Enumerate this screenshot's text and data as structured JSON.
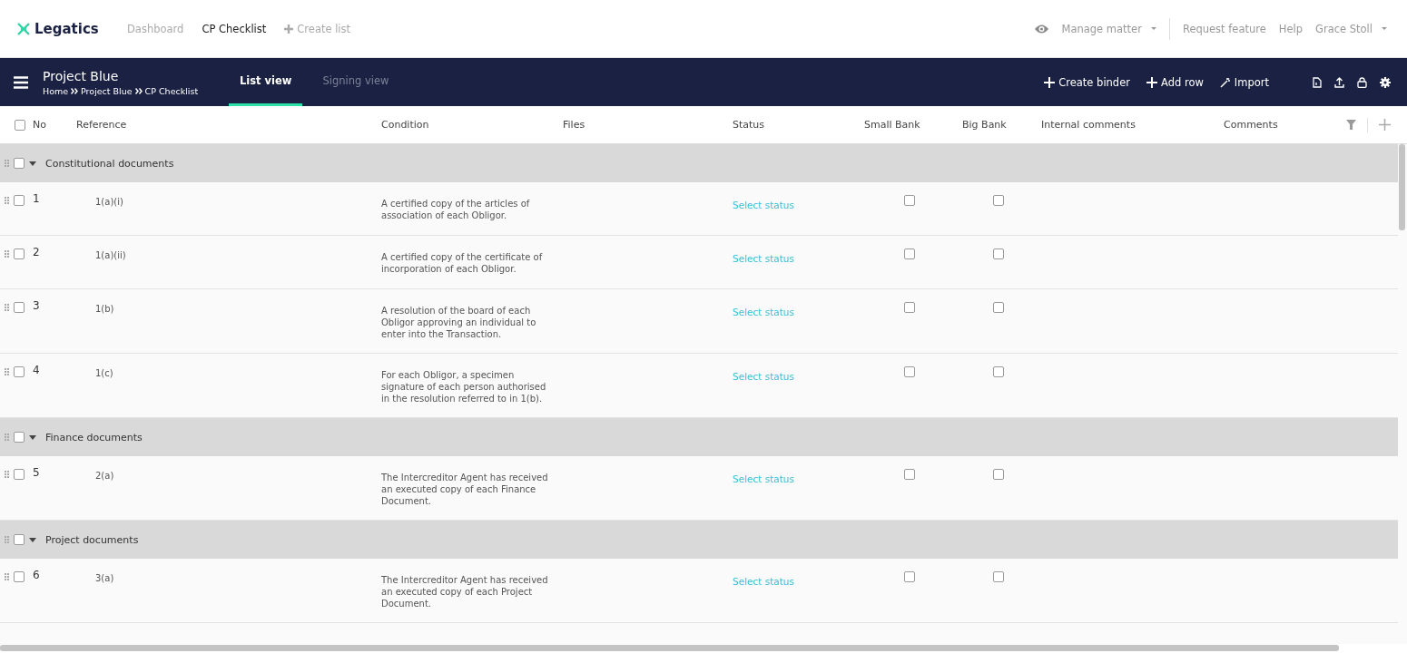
{
  "topbar": {
    "brand": "Legatics",
    "nav": [
      {
        "label": "Dashboard",
        "selected": false,
        "kind": "link"
      },
      {
        "label": "CP Checklist",
        "selected": true,
        "kind": "link"
      },
      {
        "label": "Create list",
        "selected": false,
        "kind": "create"
      }
    ],
    "manage": "Manage matter",
    "links": [
      "Request feature",
      "Help"
    ],
    "user": "Grace Stoll"
  },
  "toolbar": {
    "title": "Project Blue",
    "breadcrumb": [
      "Home",
      "Project Blue",
      "CP Checklist"
    ],
    "tabs": [
      {
        "label": "List view",
        "selected": true
      },
      {
        "label": "Signing view",
        "selected": false
      }
    ],
    "actions": [
      {
        "kind": "create",
        "label": "Create binder"
      },
      {
        "kind": "add",
        "label": "Add row"
      },
      {
        "kind": "import",
        "label": "Import"
      }
    ]
  },
  "table": {
    "select_all": false,
    "columns": [
      "No",
      "Reference",
      "Condition",
      "Files",
      "Status",
      "Small Bank",
      "Big Bank",
      "Internal comments",
      "Comments"
    ],
    "groups": [
      {
        "label": "Constitutional documents",
        "checked": false,
        "expanded": true,
        "rows": [
          {
            "no": "1",
            "reference": "1(a)(i)",
            "condition": "A certified copy of the articles of association of each Obligor.",
            "status": "Select status",
            "checked": false,
            "small_bank": false,
            "big_bank": false
          },
          {
            "no": "2",
            "reference": "1(a)(ii)",
            "condition": "A certified copy of the certificate of incorporation of each Obligor.",
            "status": "Select status",
            "checked": false,
            "small_bank": false,
            "big_bank": false
          },
          {
            "no": "3",
            "reference": "1(b)",
            "condition": "A resolution of the board of each Obligor approving an individual to enter into the Transaction.",
            "status": "Select status",
            "checked": false,
            "small_bank": false,
            "big_bank": false
          },
          {
            "no": "4",
            "reference": "1(c)",
            "condition": "For each Obligor, a specimen signature of each person authorised in the resolution referred to in 1(b).",
            "status": "Select status",
            "checked": false,
            "small_bank": false,
            "big_bank": false
          }
        ]
      },
      {
        "label": "Finance documents",
        "checked": false,
        "expanded": true,
        "rows": [
          {
            "no": "5",
            "reference": "2(a)",
            "condition": "The Intercreditor Agent has received an executed copy of each Finance Document.",
            "status": "Select status",
            "checked": false,
            "small_bank": false,
            "big_bank": false
          }
        ]
      },
      {
        "label": "Project documents",
        "checked": false,
        "expanded": true,
        "rows": [
          {
            "no": "6",
            "reference": "3(a)",
            "condition": "The Intercreditor Agent has received an executed copy of each Project Document.",
            "status": "Select status",
            "checked": false,
            "small_bank": false,
            "big_bank": false
          }
        ]
      }
    ]
  }
}
